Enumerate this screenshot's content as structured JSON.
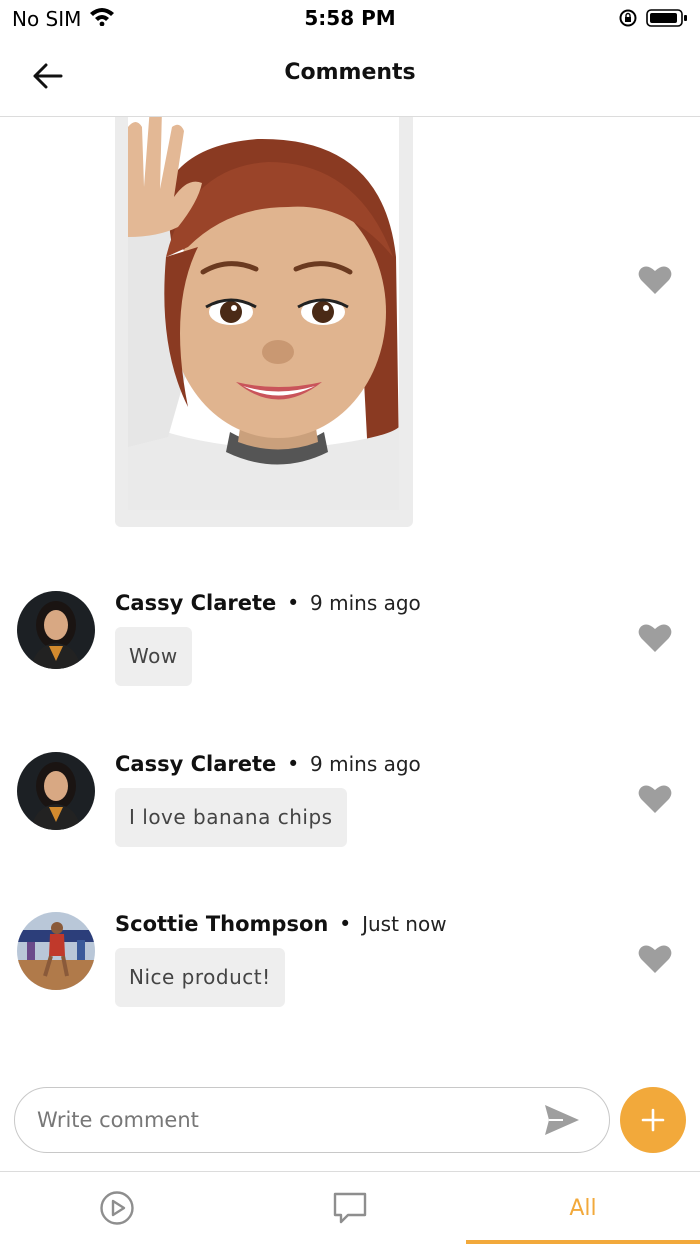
{
  "status_bar": {
    "carrier": "No SIM",
    "time": "5:58 PM"
  },
  "header": {
    "title": "Comments"
  },
  "comments": [
    {
      "author": "Cassy Clarete",
      "separator": "•",
      "time": "9 mins ago",
      "text": "Wow"
    },
    {
      "author": "Cassy Clarete",
      "separator": "•",
      "time": "9 mins ago",
      "text": "I love banana chips"
    },
    {
      "author": "Scottie Thompson",
      "separator": "•",
      "time": "Just now",
      "text": "Nice product!"
    }
  ],
  "composer": {
    "placeholder": "Write comment"
  },
  "tabs": [
    {
      "name": "play",
      "icon": "play-circle-icon"
    },
    {
      "name": "comments",
      "icon": "chat-bubble-icon"
    },
    {
      "name": "all",
      "label": "All",
      "active": true
    }
  ],
  "colors": {
    "accent": "#f2a93b",
    "heart": "#9e9e9e",
    "bubble": "#eeeeee"
  }
}
